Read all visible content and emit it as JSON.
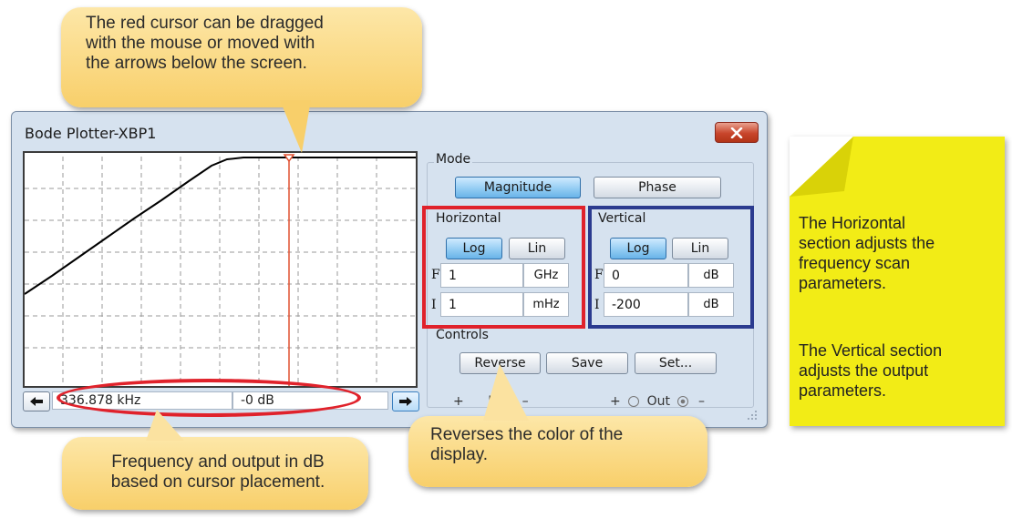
{
  "window": {
    "title": "Bode Plotter-XBP1"
  },
  "plot": {
    "cursor_color": "#e05030",
    "trace_color": "#000000"
  },
  "readout": {
    "frequency": "336.878 kHz",
    "output": "-0 dB"
  },
  "mode": {
    "label": "Mode",
    "magnitude_label": "Magnitude",
    "phase_label": "Phase",
    "selected": "Magnitude"
  },
  "horizontal": {
    "label": "Horizontal",
    "log_label": "Log",
    "lin_label": "Lin",
    "scale": "Log",
    "final_label": "F",
    "initial_label": "I",
    "final_value": "1",
    "final_unit": "GHz",
    "initial_value": "1",
    "initial_unit": "mHz"
  },
  "vertical": {
    "label": "Vertical",
    "log_label": "Log",
    "lin_label": "Lin",
    "scale": "Log",
    "final_label": "F",
    "initial_label": "I",
    "final_value": "0",
    "final_unit": "dB",
    "initial_value": "-200",
    "initial_unit": "dB"
  },
  "controls": {
    "label": "Controls",
    "reverse_label": "Reverse",
    "save_label": "Save",
    "set_label": "Set..."
  },
  "terminals": {
    "in_label": "In",
    "out_label": "Out",
    "plus": "+",
    "minus": "–"
  },
  "callouts": {
    "cursor_lines": [
      "The red cursor can be dragged",
      "with the mouse or moved with",
      "the arrows below the screen."
    ],
    "readout_lines": [
      "Frequency and output in dB",
      "based on cursor placement."
    ],
    "reverse_lines": [
      "Reverses the color of the",
      "display."
    ]
  },
  "note": {
    "horizontal_lines": [
      "The Horizontal",
      "section adjusts the",
      "frequency scan",
      "parameters."
    ],
    "vertical_lines": [
      "The Vertical section",
      "adjusts the output",
      "parameters."
    ]
  },
  "colors": {
    "highlight_red": "#e0222b",
    "highlight_blue": "#2b3b8f",
    "note_yellow": "#f2ec16",
    "callout_orange": "#f8cf6a"
  }
}
